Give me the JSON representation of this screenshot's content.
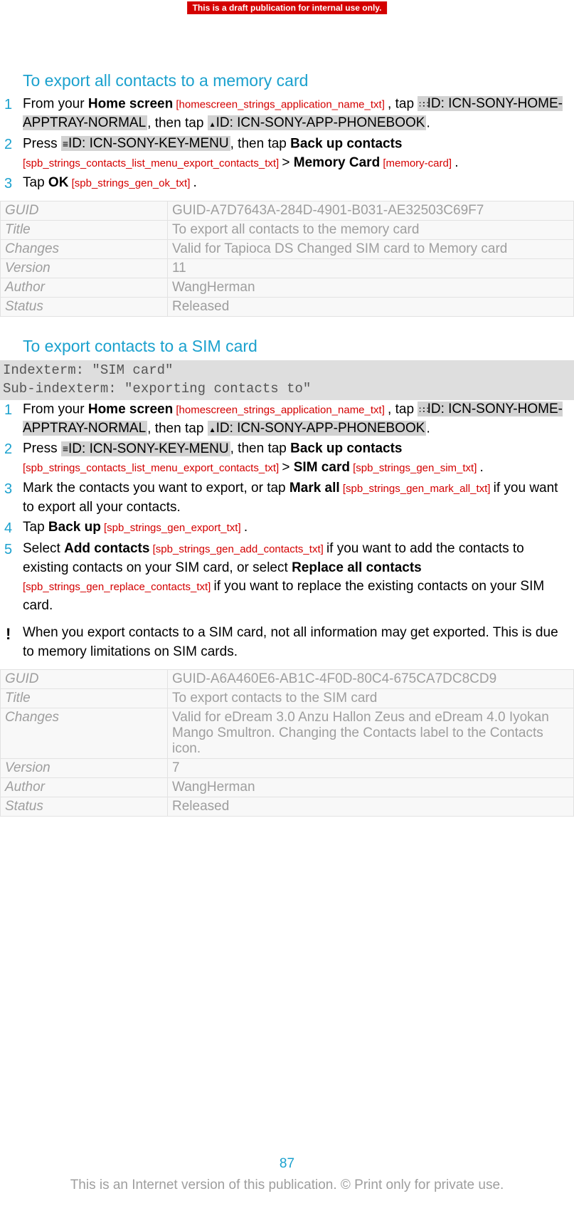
{
  "banner": "This is a draft publication for internal use only.",
  "section1": {
    "heading": "To export all contacts to a memory card",
    "steps": [
      {
        "num": "1",
        "t1": "From your ",
        "b1": "Home screen",
        "ref1": " [homescreen_strings_application_name_txt] ",
        "t2": ", tap ",
        "hl1": "ID: ICN-SONY-HOME-APPTRAY-NORMAL",
        "t3": ", then tap ",
        "hl2": "ID: ICN-SONY-APP-PHONEBOOK",
        "t4": "."
      },
      {
        "num": "2",
        "t1": "Press ",
        "hl1": "ID: ICN-SONY-KEY-MENU",
        "t2": ", then tap ",
        "b1": "Back up contacts",
        "ref1": " [spb_strings_contacts_list_menu_export_contacts_txt] ",
        "t3": "> ",
        "b2": "Memory Card",
        "ref2": " [memory-card] ",
        "t4": "."
      },
      {
        "num": "3",
        "t1": "Tap ",
        "b1": "OK",
        "ref1": " [spb_strings_gen_ok_txt] ",
        "t2": "."
      }
    ],
    "meta": {
      "GUID": "GUID-A7D7643A-284D-4901-B031-AE32503C69F7",
      "Title": "To export all contacts to the memory card",
      "Changes": "Valid for Tapioca DS Changed SIM card to Memory card",
      "Version": "11",
      "Author": "WangHerman",
      "Status": "Released"
    }
  },
  "section2": {
    "heading": "To export contacts to a SIM card",
    "index1": "Indexterm: \"SIM card\"",
    "index2": "Sub-indexterm: \"exporting contacts to\"",
    "steps": [
      {
        "num": "1",
        "t1": "From your ",
        "b1": "Home screen",
        "ref1": " [homescreen_strings_application_name_txt] ",
        "t2": ", tap ",
        "hl1": "ID: ICN-SONY-HOME-APPTRAY-NORMAL",
        "t3": ", then tap ",
        "hl2": "ID: ICN-SONY-APP-PHONEBOOK",
        "t4": "."
      },
      {
        "num": "2",
        "t1": "Press ",
        "hl1": "ID: ICN-SONY-KEY-MENU",
        "t2": ", then tap ",
        "b1": "Back up contacts",
        "ref1": " [spb_strings_contacts_list_menu_export_contacts_txt] ",
        "t3": "> ",
        "b2": "SIM card",
        "ref2": " [spb_strings_gen_sim_txt] ",
        "t4": "."
      },
      {
        "num": "3",
        "t1": "Mark the contacts you want to export, or tap ",
        "b1": "Mark all",
        "ref1": " [spb_strings_gen_mark_all_txt] ",
        "t2": "if you want to export all your contacts."
      },
      {
        "num": "4",
        "t1": "Tap ",
        "b1": "Back up",
        "ref1": " [spb_strings_gen_export_txt] ",
        "t2": "."
      },
      {
        "num": "5",
        "t1": "Select ",
        "b1": "Add contacts",
        "ref1": " [spb_strings_gen_add_contacts_txt] ",
        "t2": "if you want to add the contacts to existing contacts on your SIM card, or select ",
        "b2": "Replace all contacts",
        "ref2": "[spb_strings_gen_replace_contacts_txt] ",
        "t3": "if you want to replace the existing contacts on your SIM card."
      }
    ],
    "note": "When you export contacts to a SIM card, not all information may get exported. This is due to memory limitations on SIM cards.",
    "meta": {
      "GUID": "GUID-A6A460E6-AB1C-4F0D-80C4-675CA7DC8CD9",
      "Title": "To export contacts to the SIM card",
      "Changes": "Valid for eDream 3.0 Anzu Hallon Zeus and eDream 4.0 Iyokan Mango Smultron. Changing the Contacts label to the Contacts icon.",
      "Version": "7",
      "Author": "WangHerman",
      "Status": "Released"
    }
  },
  "metaLabels": {
    "guid": "GUID",
    "title": "Title",
    "changes": "Changes",
    "version": "Version",
    "author": "Author",
    "status": "Status"
  },
  "pageNum": "87",
  "footer": "This is an Internet version of this publication. © Print only for private use."
}
